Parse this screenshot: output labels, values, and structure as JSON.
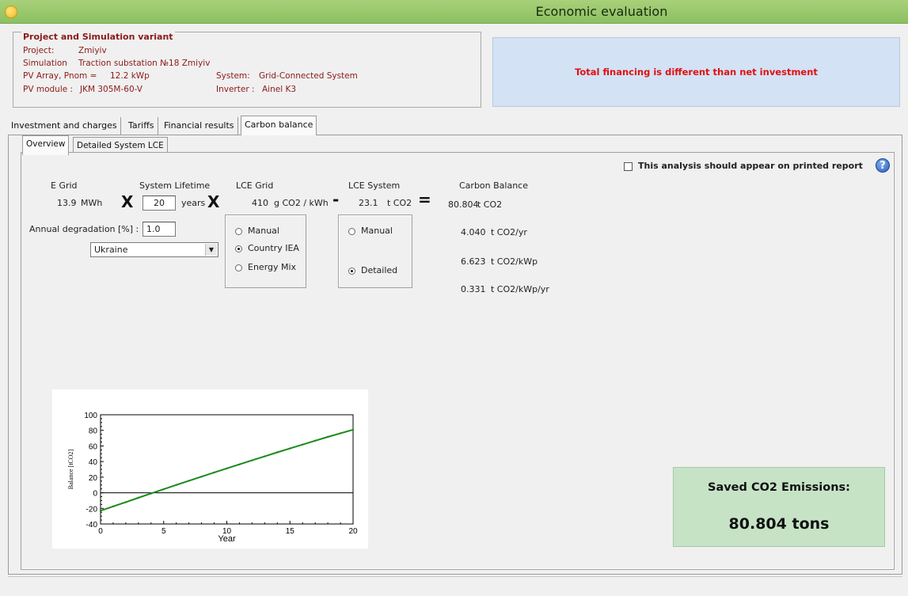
{
  "window": {
    "title": "Economic evaluation"
  },
  "project": {
    "legend": "Project and Simulation variant",
    "project_label": "Project:",
    "project_value": "Zmiyiv",
    "simulation_label": "Simulation",
    "simulation_value": "Traction substation №18 Zmiyiv",
    "pv_array_label": "PV Array, Pnom =",
    "pv_array_value": "12.2 kWp",
    "system_label": "System:",
    "system_value": "Grid-Connected System",
    "pv_module_label": "PV module :",
    "pv_module_value": "JKM 305M-60-V",
    "inverter_label": "Inverter :",
    "inverter_value": "Ainel K3"
  },
  "warning": "Total financing is different than net investment",
  "tabs": [
    {
      "label": "Investment and charges"
    },
    {
      "label": "Tariffs"
    },
    {
      "label": "Financial results"
    },
    {
      "label": "Carbon balance"
    }
  ],
  "subtabs": [
    {
      "label": "Overview"
    },
    {
      "label": "Detailed System LCE"
    }
  ],
  "print_checkbox": {
    "label": "This analysis should appear on printed report",
    "checked": false
  },
  "calc": {
    "egrid_label": "E Grid",
    "egrid_value": "13.9",
    "egrid_unit": "MWh",
    "times1": "X",
    "lifetime_label": "System Lifetime",
    "lifetime_value": "20",
    "lifetime_unit": "years",
    "times2": "X",
    "lce_grid_label": "LCE Grid",
    "lce_grid_value": "410",
    "lce_grid_unit": "g CO2 / kWh",
    "minus": "-",
    "lce_system_label": "LCE System",
    "lce_system_value": "23.1",
    "lce_system_unit": "t CO2",
    "equals": "=",
    "carbon_label": "Carbon Balance",
    "carbon_values": [
      {
        "value": "80.804",
        "unit": "t CO2"
      },
      {
        "value": "4.040",
        "unit": "t CO2/yr"
      },
      {
        "value": "6.623",
        "unit": "t CO2/kWp"
      },
      {
        "value": "0.331",
        "unit": "t CO2/kWp/yr"
      }
    ],
    "degradation_label": "Annual degradation [%] :",
    "degradation_value": "1.0",
    "country_selected": "Ukraine"
  },
  "lce_grid_options": [
    {
      "label": "Manual",
      "selected": false
    },
    {
      "label": "Country IEA",
      "selected": true
    },
    {
      "label": "Energy Mix",
      "selected": false
    }
  ],
  "lce_system_options": [
    {
      "label": "Manual",
      "selected": false
    },
    {
      "label": "Detailed",
      "selected": true
    }
  ],
  "saved": {
    "title": "Saved CO2 Emissions:",
    "value": "80.804 tons"
  },
  "colors": {
    "titlebar": "#8cc060",
    "warning_bg": "#d3e2f5",
    "warning_text": "#e01010",
    "saved_bg": "#c6e3c6",
    "line": "#1a8a1a"
  },
  "chart_data": {
    "type": "line",
    "xlabel": "Year",
    "ylabel": "Balance [tCO2]",
    "xlim": [
      0,
      20
    ],
    "ylim": [
      -40,
      100
    ],
    "x_ticks": [
      "0",
      "5",
      "10",
      "15",
      "20"
    ],
    "y_ticks": [
      "100",
      "80",
      "60",
      "40",
      "20",
      "0",
      "-20",
      "-40"
    ],
    "series": [
      {
        "x": [
          0,
          1,
          2,
          3,
          4,
          5,
          6,
          7,
          8,
          9,
          10,
          11,
          12,
          13,
          14,
          15,
          16,
          17,
          18,
          19,
          20
        ],
        "values": [
          -23.1,
          -17.5,
          -12.0,
          -6.4,
          -0.9,
          4.6,
          10.0,
          15.4,
          20.7,
          26.0,
          31.2,
          36.4,
          41.6,
          46.7,
          51.8,
          56.8,
          61.8,
          66.7,
          71.6,
          76.2,
          80.8
        ]
      }
    ],
    "zero_line": true
  }
}
